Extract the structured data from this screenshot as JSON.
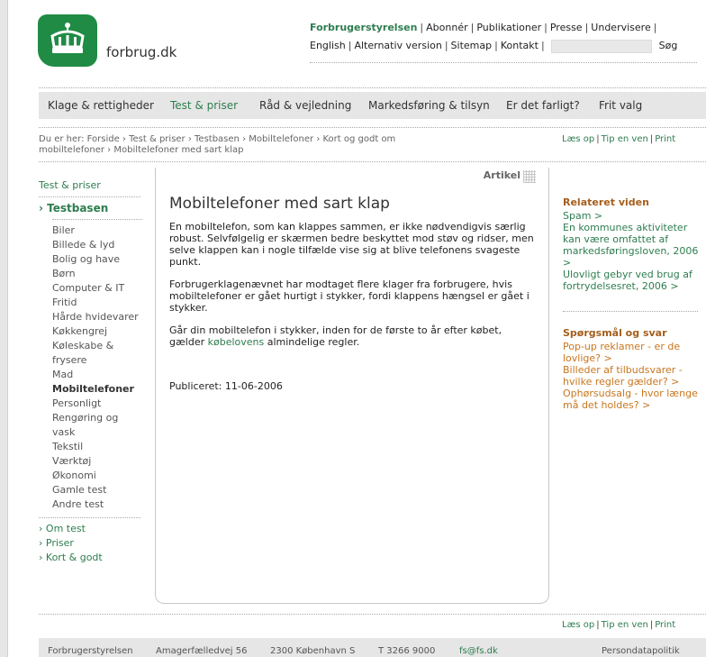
{
  "site": {
    "name": "forbrug.dk"
  },
  "top_links": {
    "row1": [
      "Forbrugerstyrelsen",
      "Abonnér",
      "Publikationer",
      "Presse",
      "Undervisere"
    ],
    "row2": [
      "English",
      "Alternativ version",
      "Sitemap",
      "Kontakt"
    ],
    "search_button": "Søg",
    "search_value": ""
  },
  "nav": [
    "Klage & rettigheder",
    "Test & priser",
    "Råd & vejledning",
    "Markedsføring & tilsyn",
    "Er det farligt?",
    "Frit valg"
  ],
  "breadcrumb": "Du er her: Forside › Test & priser › Testbasen › Mobiltelefoner › Kort og godt om mobiltelefoner › Mobiltelefoner med sart klap",
  "util_links": [
    "Læs op",
    "Tip en ven",
    "Print"
  ],
  "left_nav": {
    "section": "Test & priser",
    "main": "Testbasen",
    "items": [
      "Biler",
      "Billede & lyd",
      "Bolig og have",
      "Børn",
      "Computer & IT",
      "Fritid",
      "Hårde hvidevarer",
      "Køkkengrej",
      "Køleskabe & frysere",
      "Mad",
      "Mobiltelefoner",
      "Personligt",
      "Rengøring og vask",
      "Tekstil",
      "Værktøj",
      "Økonomi",
      "Gamle test",
      "Andre test"
    ],
    "current": "Mobiltelefoner",
    "bottom": [
      "Om test",
      "Priser",
      "Kort & godt"
    ]
  },
  "article": {
    "label": "Artikel",
    "title": "Mobiltelefoner med sart klap",
    "p1": "En mobiltelefon, som kan klappes sammen, er ikke nødvendigvis særlig robust. Selvfølgelig er skærmen bedre beskyttet mod støv og ridser, men selve klappen kan i nogle tilfælde vise sig at blive telefonens svageste punkt.",
    "p2": "Forbrugerklagenævnet har modtaget flere klager fra forbrugere, hvis mobiltelefoner er gået hurtigt i stykker, fordi klappens hængsel er gået i stykker.",
    "p3_before": "Går din mobiltelefon i stykker, inden for de første to år efter købet, gælder ",
    "p3_link": "købelovens",
    "p3_after": " almindelige regler.",
    "published": "Publiceret: 11-06-2006"
  },
  "related": {
    "heading": "Relateret viden",
    "items": [
      "Spam >",
      "En kommunes aktiviteter kan være omfattet af markedsføringsloven, 2006 >",
      "Ulovligt gebyr ved brug af fortrydelsesret, 2006 >"
    ]
  },
  "qa": {
    "heading": "Spørgsmål og svar",
    "items": [
      "Pop-up reklamer - er de lovlige? >",
      "Billeder af tilbudsvarer - hvilke regler gælder? >",
      "Ophørsudsalg - hvor længe må det holdes? >"
    ]
  },
  "footer": {
    "org": "Forbrugerstyrelsen",
    "address": "Amagerfælledvej 56",
    "city": "2300 København S",
    "phone": "T 3266 9000",
    "email": "fs@fs.dk",
    "privacy": "Persondatapolitik"
  }
}
